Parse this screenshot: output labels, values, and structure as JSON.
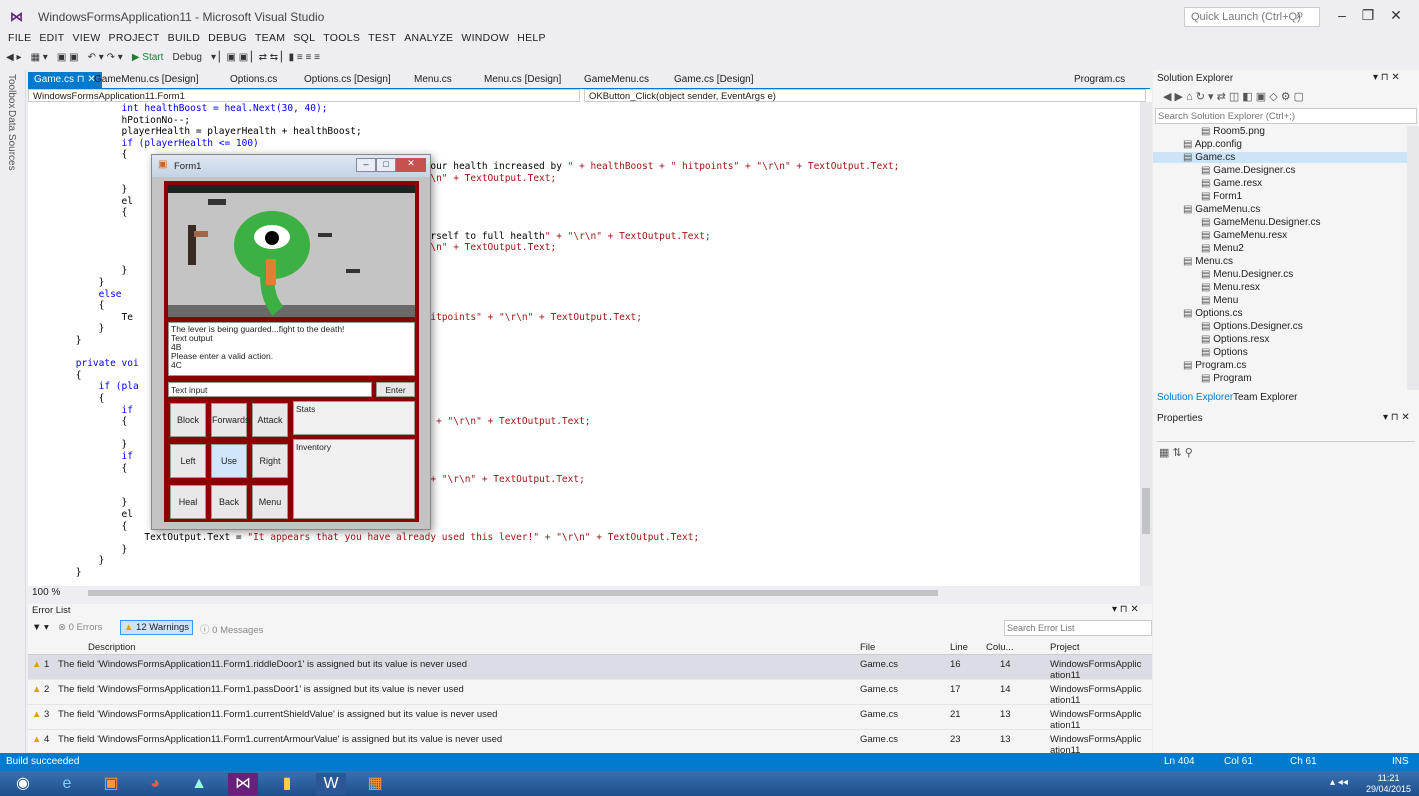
{
  "window": {
    "title": "WindowsFormsApplication11 - Microsoft Visual Studio",
    "quick_launch": "Quick Launch (Ctrl+Q)"
  },
  "menu": [
    "FILE",
    "EDIT",
    "VIEW",
    "PROJECT",
    "BUILD",
    "DEBUG",
    "TEAM",
    "SQL",
    "TOOLS",
    "TEST",
    "ANALYZE",
    "WINDOW",
    "HELP"
  ],
  "toolbar": {
    "start": "▶ Start",
    "config": "Debug"
  },
  "side_tabs": {
    "toolbox": "Toolbox",
    "data_sources": "Data Sources"
  },
  "tabs": [
    "Game.cs",
    "GameMenu.cs [Design]",
    "Options.cs",
    "Options.cs [Design]",
    "Menu.cs",
    "Menu.cs [Design]",
    "GameMenu.cs",
    "Game.cs [Design]",
    "Program.cs"
  ],
  "nav": {
    "class": "WindowsFormsApplication11.Form1",
    "member": "OKButton_Click(object sender, EventArgs e)"
  },
  "code_lines": [
    "                int healthBoost = heal.Next(30, 40);",
    "                hPotionNo--;",
    "                playerHealth = playerHealth + healthBoost;",
    "                if (playerHealth <= 100)",
    "                {",
    "                                                       ck and heal.  Your health increased by \" + healthBoost + \" hitpoints\" + \"\\r\\n\" + TextOutput.Text;",
    "                                                       itpoints\" + \"\\r\\n\" + TextOutput.Text;",
    "                }",
    "                el",
    "                {",
    "",
    "                                                       ck and heal yourself to full health\" + \"\\r\\n\" + TextOutput.Text;",
    "                                                       itpoints\" + \"\\r\\n\" + TextOutput.Text;",
    "",
    "                }",
    "            }",
    "            else",
    "            {",
    "                Te                                    ayerHealth + \" hitpoints\" + \"\\r\\n\" + TextOutput.Text;",
    "            }",
    "        }",
    "",
    "        private voi",
    "        {",
    "            if (pla",
    "            {",
    "                if",
    "                {                                      lunking noise.\" + \"\\r\\n\" + TextOutput.Text;",
    "",
    "                }",
    "                if",
    "                {",
    "                                                       to the death!\" + \"\\r\\n\" + TextOutput.Text;",
    "",
    "                }",
    "                el",
    "                {",
    "                    TextOutput.Text = \"It appears that you have already used this lever!\" + \"\\r\\n\" + TextOutput.Text;",
    "                }",
    "            }",
    "        }"
  ],
  "zoom": "100 %",
  "form1": {
    "title": "Form1",
    "output_lines": [
      "The lever is being guarded...fight to the death!",
      "Text output",
      "4B",
      "Please enter a valid action.",
      "4C"
    ],
    "input": "Text input",
    "enter": "Enter",
    "buttons": [
      [
        "Block",
        "Forwards",
        "Attack"
      ],
      [
        "Left",
        "Use",
        "Right"
      ],
      [
        "Heal",
        "Back",
        "Menu"
      ]
    ],
    "stats": "Stats",
    "inventory": "Inventory"
  },
  "solution_explorer": {
    "title": "Solution Explorer",
    "search": "Search Solution Explorer (Ctrl+;)",
    "items": [
      {
        "label": "Room5.png",
        "indent": 2
      },
      {
        "label": "App.config",
        "indent": 1
      },
      {
        "label": "Game.cs",
        "indent": 1,
        "selected": true
      },
      {
        "label": "Game.Designer.cs",
        "indent": 2
      },
      {
        "label": "Game.resx",
        "indent": 2
      },
      {
        "label": "Form1",
        "indent": 2
      },
      {
        "label": "GameMenu.cs",
        "indent": 1
      },
      {
        "label": "GameMenu.Designer.cs",
        "indent": 2
      },
      {
        "label": "GameMenu.resx",
        "indent": 2
      },
      {
        "label": "Menu2",
        "indent": 2
      },
      {
        "label": "Menu.cs",
        "indent": 1
      },
      {
        "label": "Menu.Designer.cs",
        "indent": 2
      },
      {
        "label": "Menu.resx",
        "indent": 2
      },
      {
        "label": "Menu",
        "indent": 2
      },
      {
        "label": "Options.cs",
        "indent": 1
      },
      {
        "label": "Options.Designer.cs",
        "indent": 2
      },
      {
        "label": "Options.resx",
        "indent": 2
      },
      {
        "label": "Options",
        "indent": 2
      },
      {
        "label": "Program.cs",
        "indent": 1
      },
      {
        "label": "Program",
        "indent": 2
      }
    ],
    "tab1": "Solution Explorer",
    "tab2": "Team Explorer"
  },
  "properties": {
    "title": "Properties"
  },
  "error_list": {
    "title": "Error List",
    "errors": "0 Errors",
    "warnings": "12 Warnings",
    "messages": "0 Messages",
    "search": "Search Error List",
    "columns": [
      "Description",
      "File",
      "Line",
      "Colu...",
      "Project"
    ],
    "rows": [
      {
        "n": "1",
        "desc": "The field 'WindowsFormsApplication11.Form1.riddleDoor1' is assigned but its value is never used",
        "file": "Game.cs",
        "line": "16",
        "col": "14",
        "project": "WindowsFormsApplic ation11"
      },
      {
        "n": "2",
        "desc": "The field 'WindowsFormsApplication11.Form1.passDoor1' is assigned but its value is never used",
        "file": "Game.cs",
        "line": "17",
        "col": "14",
        "project": "WindowsFormsApplic ation11"
      },
      {
        "n": "3",
        "desc": "The field 'WindowsFormsApplication11.Form1.currentShieldValue' is assigned but its value is never used",
        "file": "Game.cs",
        "line": "21",
        "col": "13",
        "project": "WindowsFormsApplic ation11"
      },
      {
        "n": "4",
        "desc": "The field 'WindowsFormsApplication11.Form1.currentArmourValue' is assigned but its value is never used",
        "file": "Game.cs",
        "line": "23",
        "col": "13",
        "project": "WindowsFormsApplic ation11"
      }
    ]
  },
  "status": {
    "left": "Build succeeded",
    "ln": "Ln 404",
    "col": "Col 61",
    "ch": "Ch 61",
    "mode": "INS"
  },
  "clock": {
    "time": "11:21",
    "date": "29/04/2015"
  }
}
